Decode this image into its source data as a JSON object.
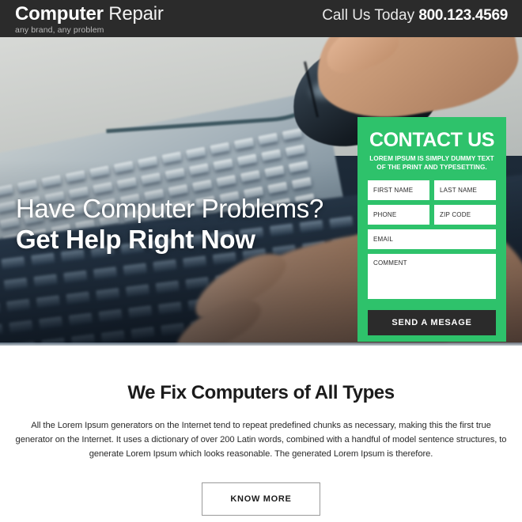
{
  "header": {
    "brand_bold": "Computer",
    "brand_light": "Repair",
    "tagline": "any brand, any problem",
    "call_label": "Call Us Today",
    "phone": "800.123.4569",
    "bg_color": "#2b2b2b"
  },
  "hero": {
    "headline_line1": "Have Computer Problems?",
    "headline_line2": "Get Help Right Now",
    "image_alt": "hand-on-mouse-and-keyboard-photo"
  },
  "contact": {
    "title": "CONTACT US",
    "subtitle": "LOREM IPSUM IS SIMPLY DUMMY TEXT OF THE PRINT AND TYPESETTING.",
    "accent_color": "#2ec26b",
    "fields": {
      "first_name": "FIRST NAME",
      "last_name": "LAST NAME",
      "phone": "PHONE",
      "zip_code": "ZIP CODE",
      "email": "EMAIL",
      "comment": "COMMENT"
    },
    "submit_label": "SEND A MESAGE",
    "submit_color": "#2b2b2b"
  },
  "content": {
    "title": "We Fix Computers of All Types",
    "paragraph": "All the Lorem Ipsum generators on the Internet tend to repeat predefined chunks as necessary, making this the first true generator on the Internet. It uses a dictionary of over 200 Latin words, combined with a handful of model sentence structures, to generate Lorem Ipsum which looks reasonable. The generated Lorem Ipsum is therefore.",
    "cta_label": "KNOW MORE"
  }
}
